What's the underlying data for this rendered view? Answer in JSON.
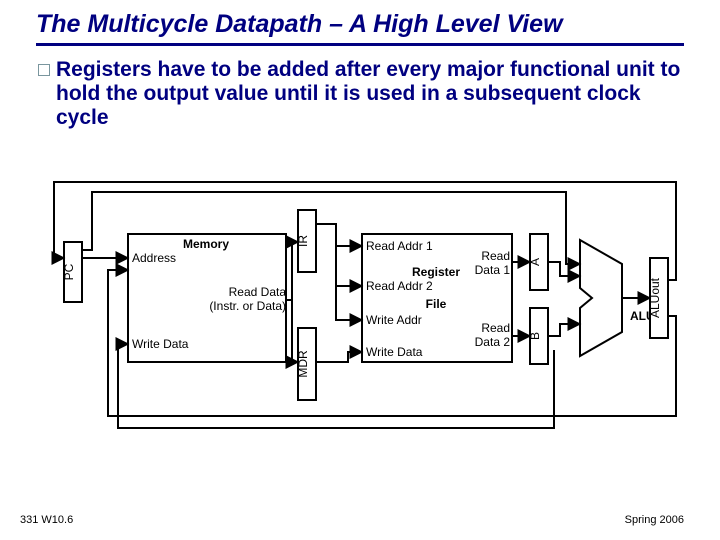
{
  "title": "The Multicycle Datapath – A High Level View",
  "bullet": "Registers have to be added after every major functional unit to hold the output value until it is used in a subsequent clock cycle",
  "footer": {
    "left": "331 W10.6",
    "right": "Spring 2006"
  },
  "blocks": {
    "pc": "PC",
    "memory": "Memory",
    "mem_addr": "Address",
    "mem_read1": "Read Data",
    "mem_read2": "(Instr. or Data)",
    "mem_write": "Write Data",
    "ir": "IR",
    "mdr": "MDR",
    "rf_title1": "Register",
    "rf_title2": "File",
    "rf_ra1": "Read Addr 1",
    "rf_ra2": "Read Addr 2",
    "rf_wa": "Write Addr",
    "rf_wd": "Write Data",
    "rf_rd1a": "Read",
    "rf_rd1b": "Data 1",
    "rf_rd2a": "Read",
    "rf_rd2b": "Data 2",
    "a": "A",
    "b": "B",
    "alu": "ALU",
    "aluout": "ALUout"
  },
  "chart_data": {
    "type": "diagram",
    "title": "Multicycle Datapath High Level View",
    "components": [
      "PC",
      "Memory",
      "IR",
      "MDR",
      "Register File",
      "A",
      "B",
      "ALU",
      "ALUout"
    ],
    "registers_added": [
      "IR",
      "MDR",
      "A",
      "B",
      "ALUout"
    ],
    "connections": [
      {
        "from": "PC",
        "to": "Memory.Address"
      },
      {
        "from": "Memory.ReadData",
        "to": "IR"
      },
      {
        "from": "Memory.ReadData",
        "to": "MDR"
      },
      {
        "from": "IR",
        "to": "RegisterFile.ReadAddr1"
      },
      {
        "from": "IR",
        "to": "RegisterFile.ReadAddr2"
      },
      {
        "from": "IR",
        "to": "RegisterFile.WriteAddr"
      },
      {
        "from": "MDR",
        "to": "RegisterFile.WriteData"
      },
      {
        "from": "RegisterFile.ReadData1",
        "to": "A"
      },
      {
        "from": "RegisterFile.ReadData2",
        "to": "B"
      },
      {
        "from": "A",
        "to": "ALU.in1"
      },
      {
        "from": "B",
        "to": "ALU.in2"
      },
      {
        "from": "PC",
        "to": "ALU.in1"
      },
      {
        "from": "ALU",
        "to": "ALUout"
      },
      {
        "from": "ALUout",
        "to": "PC"
      },
      {
        "from": "ALUout",
        "to": "Memory.Address"
      },
      {
        "from": "B",
        "to": "Memory.WriteData"
      }
    ]
  }
}
